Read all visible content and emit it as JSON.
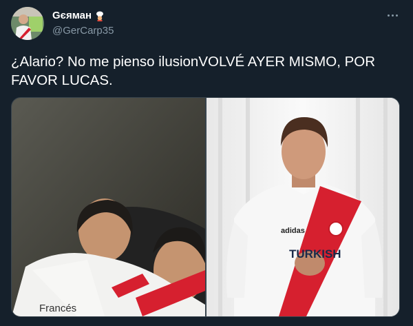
{
  "tweet": {
    "display_name": "Gєяман",
    "handle": "@GerCarp35",
    "text": "¿Alario? No me pienso ilusionVOLVÉ AYER MISMO, POR FAVOR LUCAS.",
    "more_icon": "more-horizontal-icon",
    "name_emoji": "chef-icon"
  },
  "photos": {
    "left_jersey_sponsor": "Francés",
    "right_jersey_sponsor": "TURKISH",
    "right_jersey_brand": "adidas"
  },
  "colors": {
    "background": "#15202b",
    "secondary_text": "#8899a6",
    "border": "#38444d",
    "river_red": "#d6202f"
  }
}
